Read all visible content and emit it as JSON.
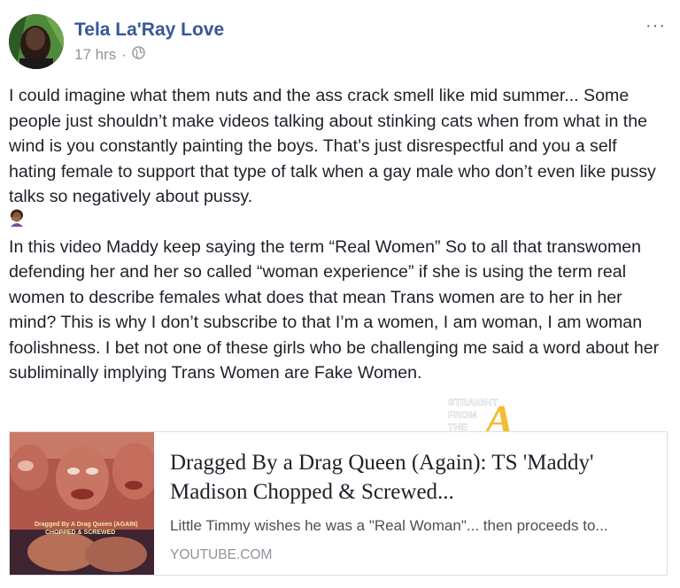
{
  "post": {
    "author": "Tela La'Ray Love",
    "timestamp": "17 hrs",
    "separator": "·",
    "privacy_icon": "globe-icon",
    "more_icon": "more-options-icon",
    "more_label": "···",
    "paragraph1": "I could imagine what them nuts and the ass crack smell like mid summer... Some people just shouldn’t make videos talking about stinking cats when from what in the wind is you constantly painting the boys. That’s just disrespectful and you a self hating female to support that type of talk when a gay male who don’t even like pussy talks so negatively about pussy.",
    "emoji": "woman-facepalming-emoji",
    "paragraph2": "In this video Maddy keep saying the term “Real Women” So to all that transwomen defending her and her so called “woman experience” if she is using the term real women to describe females what does that mean Trans women are to her in her mind? This is why I don’t subscribe to that I’m a women, I am woman, I am woman foolishness. I bet not one of these girls who be challenging me said a word about her subliminally implying Trans Women are Fake Women."
  },
  "watermark": {
    "line1": "STRAIGHT",
    "line2": "FROM",
    "line3": "THE",
    "letter": "A"
  },
  "link_card": {
    "thumb_caption_line1": "Dragged By A Drag Queen (AGAIN)",
    "thumb_caption_line2": "CHOPPED & SCREWED",
    "title": "Dragged By a Drag Queen (Again): TS 'Maddy' Madison Chopped & Screwed...",
    "description": "Little Timmy wishes he was a \"Real Woman\"... then proceeds to...",
    "domain": "YOUTUBE.COM"
  },
  "colors": {
    "author_link": "#365899",
    "meta_gray": "#90949c",
    "card_border": "#dddfe2",
    "watermark_gold": "#f2b51c"
  }
}
